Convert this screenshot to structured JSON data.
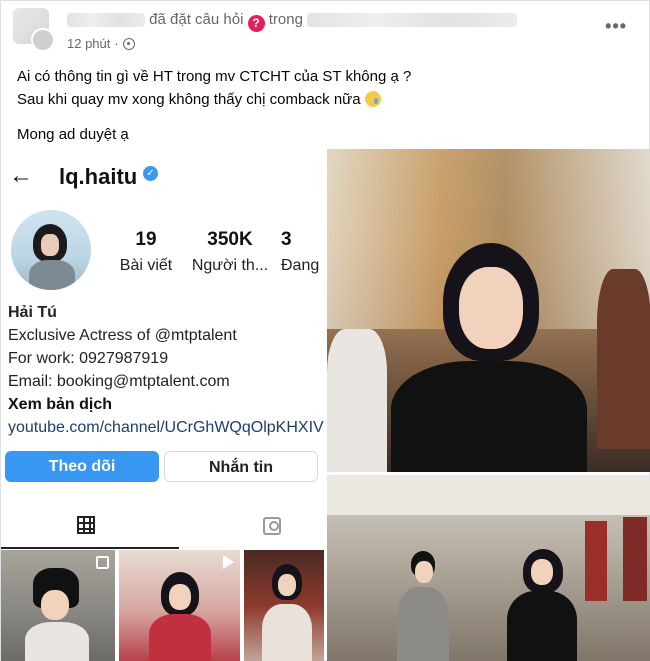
{
  "post": {
    "asked_text": "đã đặt câu hỏi",
    "question_badge": "?",
    "in_text": "trong",
    "time": "12 phút",
    "more_label": "•••",
    "lines": [
      "Ai có thông tin gì về HT trong mv CTCHT của ST không ạ ?",
      "Sau khi quay mv xong không thấy chị comback nữa",
      "Mong ad duyệt ạ"
    ]
  },
  "instagram": {
    "back_label": "←",
    "handle": "lq.haitu",
    "verified_label": "✓",
    "stats": [
      {
        "value": "19",
        "label": "Bài viết"
      },
      {
        "value": "350K",
        "label": "Người th..."
      },
      {
        "value": "3",
        "label": "Đang th"
      }
    ],
    "bio": {
      "name": "Hải Tú",
      "line1": "Exclusive Actress of @mtptalent",
      "line2": "For work: 0927987919",
      "line3": "Email: booking@mtptalent.com",
      "translate": "Xem bản dịch",
      "link": "youtube.com/channel/UCrGhWQqOlpKHXIV"
    },
    "follow_label": "Theo dõi",
    "message_label": "Nhắn tin"
  },
  "icons": [
    "globe-icon",
    "more-icon",
    "back-arrow-icon",
    "verified-icon",
    "grid-tab-icon",
    "tagged-tab-icon",
    "multi-photo-icon",
    "reel-icon"
  ],
  "colors": {
    "accent": "#3897f0",
    "question_badge": "#e41e5a",
    "meta_text": "#65676b"
  }
}
